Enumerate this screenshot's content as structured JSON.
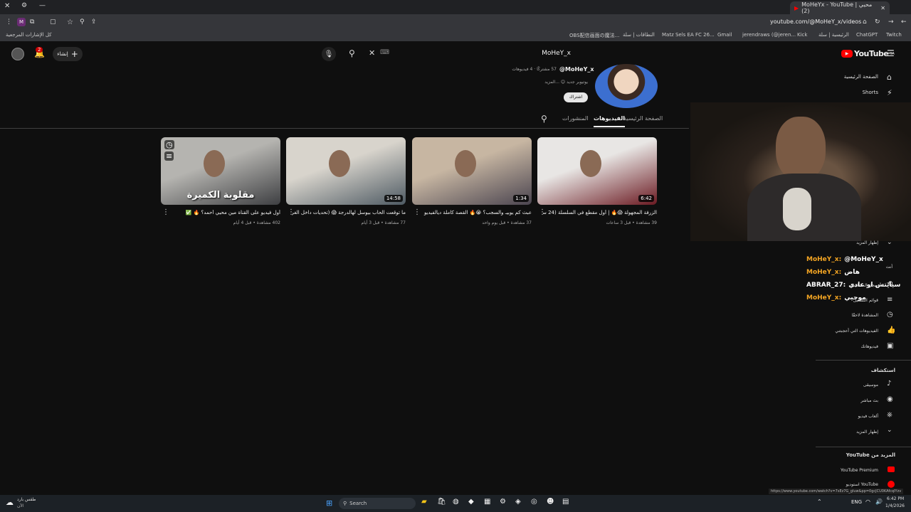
{
  "browser": {
    "tab_title": "MoHeYx - YouTube | محيي (2)",
    "url": "youtube.com/@MoHeY_x/videos",
    "bookmarks": [
      "كل الإشارات المرجعية",
      "OBS配信画面の魔法...",
      "النطاقات | سلة",
      "Matz Sels EA FC 26...",
      "Gmail",
      "jerendraws (@jeren...",
      "Kick",
      "الرئيسية | سلة",
      "ChatGPT",
      "Twitch"
    ],
    "status_url": "https://www.youtube.com/watch?v=7sEz7G_gluw&pp=0gcJCU0KAfcqIYzv"
  },
  "topbar": {
    "create_label": "إنشاء",
    "notif_count": "2",
    "search_value": "MoHeY_x",
    "logo": "YouTube",
    "logo_region": "SA"
  },
  "channel": {
    "handle": "@MoHeY_x",
    "stats": "57 مشتركًا · 4 فيديوهات",
    "desc": "يوتيوبر جديد 😊 ...المزيد",
    "subscribe": "اشتراك",
    "tabs": {
      "home": "الصفحة الرئيسية",
      "videos": "الفيديوهات",
      "posts": "المنشورات"
    }
  },
  "videos": [
    {
      "title": "الزرفة المجهولة 😱🔥 | أول مقطع في السلسلة (24 ساعة)",
      "meta": "39 مشاهدة • قبل 3 ساعات",
      "duration": "6:42",
      "colors": [
        "#e8e6e4",
        "#6b1a22"
      ]
    },
    {
      "title": "عبث كم يوبيـ والسجب؟ 😭🔥 القصة كاملة ديالفيديو",
      "meta": "37 مشاهدة • قبل يوم واحد",
      "duration": "1:34",
      "colors": [
        "#c7b6a2",
        "#4b4550"
      ]
    },
    {
      "title": "ما توقعت الحاب بيوسل لهالدرجة 😱 (تحديات داخل الغرفة",
      "meta": "77 مشاهدة • قبل 3 أيام",
      "duration": "14:58",
      "colors": [
        "#d8d4cc",
        "#4e5a63"
      ]
    },
    {
      "title": "أول فيديو على القناة مين محيي أحمد؟ 🔥 ✅",
      "meta": "402 مشاهدة • قبل 4 أيام",
      "duration": "",
      "overlay": "مقلوبة الكميرة",
      "colors": [
        "#b5b4b0",
        "#3e3f42"
      ]
    }
  ],
  "sidebar": {
    "home": "الصفحة الرئيسية",
    "shorts": "Shorts",
    "show_more": "إظهار المزيد",
    "you": "أنت",
    "history": "سجل المشاهدة",
    "playlists": "قوائم التشغيل",
    "watch_later": "المشاهدة لاحقًا",
    "liked": "الفيديوهات التي أعجبتني",
    "your_videos": "فيديوهاتك",
    "explore": "استكشاف",
    "music": "موسيقى",
    "live": "بث مباشر",
    "gaming": "ألعاب فيديو",
    "show_more2": "إظهار المزيد",
    "more_from": "المزيد من YouTube",
    "premium": "YouTube Premium",
    "studio": "YouTube استوديو"
  },
  "chat": [
    {
      "user": "MoHeY_x:",
      "msg": "@MoHeY_x",
      "color": "#f5a623"
    },
    {
      "user": "MoHeY_x:",
      "msg": "هاض",
      "color": "#f5a623"
    },
    {
      "user": "ABRAR_27:",
      "msg": "سيايتش او عادي",
      "color": "#ffffff"
    },
    {
      "user": "MoHeY_x:",
      "msg": "موحيي",
      "color": "#f5a623"
    }
  ],
  "taskbar": {
    "weather": "طقس بارد",
    "weather2": "الآن",
    "search": "Search",
    "lang": "ENG",
    "time": "6:42 PM",
    "date": "1/4/2026"
  }
}
